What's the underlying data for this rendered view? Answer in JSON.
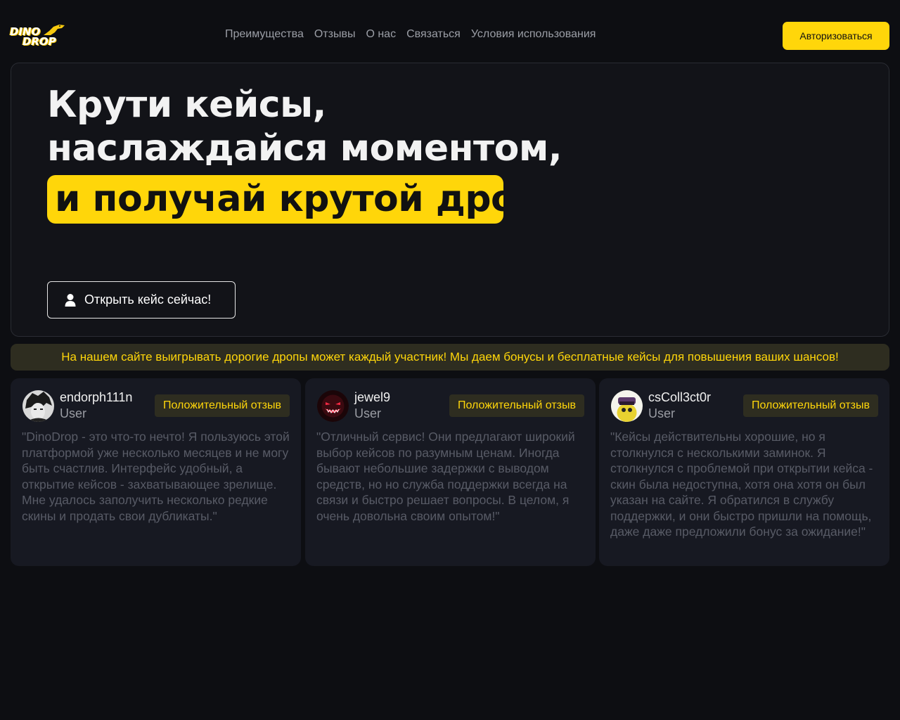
{
  "header": {
    "logo_line1": "DINO",
    "logo_line2": "DROP",
    "nav": [
      "Преимущества",
      "Отзывы",
      "О нас",
      "Связаться",
      "Условия использования"
    ],
    "auth_label": "Авторизоваться"
  },
  "hero": {
    "line1": "Крути кейсы,",
    "line2": "наслаждайся моментом,",
    "highlight": "и получай крутой дроп!",
    "cta_label": "Открыть кейс сейчас!"
  },
  "banner": "На нашем сайте выигрывать дорогие дропы может каждый участник! Мы даем бонусы и бесплатные кейсы для повышения ваших шансов!",
  "reviews": [
    {
      "username": "endorph111n",
      "role": "User",
      "badge": "Положительный отзыв",
      "text": "\"DinoDrop - это что-то нечто! Я пользуюсь этой платформой уже несколько месяцев и не могу быть счастлив. Интерфейс удобный, а открытие кейсов - захватывающее зрелище. Мне удалось заполучить несколько редкие скины и продать свои дубликаты.\""
    },
    {
      "username": "jewel9",
      "role": "User",
      "badge": "Положительный отзыв",
      "text": "\"Отличный сервис! Они предлагают широкий выбор кейсов по разумным ценам. Иногда бывают небольшие задержки с выводом средств, но но служба поддержки всегда на связи и быстро решает вопросы. В целом, я очень довольна своим опытом!\""
    },
    {
      "username": "csColl3ct0r",
      "role": "User",
      "badge": "Положительный отзыв",
      "text": "\"Кейсы действительны хорошие, но я столкнулся с несколькими заминок. Я столкнулся с проблемой при открытии кейса - скин была недоступна, хотя она хотя он был указан на сайте. Я обратился в службу поддержки, и они быстро пришли на помощь, даже даже предложили бонус за ожидание!\""
    }
  ],
  "colors": {
    "accent": "#ffd60a",
    "background": "#0d0e12",
    "card": "#171922"
  }
}
